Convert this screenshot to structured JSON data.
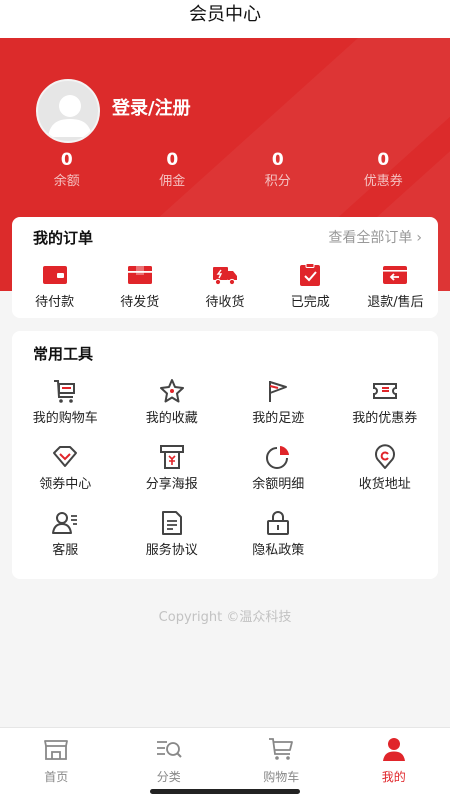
{
  "title": "会员中心",
  "user": {
    "login_label": "登录/注册"
  },
  "stats": [
    {
      "value": "0",
      "label": "余额"
    },
    {
      "value": "0",
      "label": "佣金"
    },
    {
      "value": "0",
      "label": "积分"
    },
    {
      "value": "0",
      "label": "优惠券"
    }
  ],
  "orders": {
    "title": "我的订单",
    "view_all": "查看全部订单",
    "items": [
      {
        "label": "待付款",
        "icon": "wallet-icon"
      },
      {
        "label": "待发货",
        "icon": "package-icon"
      },
      {
        "label": "待收货",
        "icon": "truck-icon"
      },
      {
        "label": "已完成",
        "icon": "clipboard-check-icon"
      },
      {
        "label": "退款/售后",
        "icon": "refund-icon"
      }
    ]
  },
  "tools": {
    "title": "常用工具",
    "items": [
      {
        "label": "我的购物车",
        "icon": "cart-icon"
      },
      {
        "label": "我的收藏",
        "icon": "star-icon"
      },
      {
        "label": "我的足迹",
        "icon": "flag-icon"
      },
      {
        "label": "我的优惠券",
        "icon": "ticket-icon"
      },
      {
        "label": "领券中心",
        "icon": "diamond-icon"
      },
      {
        "label": "分享海报",
        "icon": "poster-icon"
      },
      {
        "label": "余额明细",
        "icon": "pie-chart-icon"
      },
      {
        "label": "收货地址",
        "icon": "location-icon"
      },
      {
        "label": "客服",
        "icon": "customer-service-icon"
      },
      {
        "label": "服务协议",
        "icon": "document-icon"
      },
      {
        "label": "隐私政策",
        "icon": "lock-icon"
      }
    ]
  },
  "copyright": "Copyright ©温众科技",
  "tabs": [
    {
      "label": "首页",
      "icon": "home-icon",
      "active": false
    },
    {
      "label": "分类",
      "icon": "category-search-icon",
      "active": false
    },
    {
      "label": "购物车",
      "icon": "cart-icon",
      "active": false
    },
    {
      "label": "我的",
      "icon": "user-icon",
      "active": true
    }
  ],
  "colors": {
    "brand": "#dc2b2b",
    "accent": "#e0252a",
    "icon_dark": "#444444"
  }
}
